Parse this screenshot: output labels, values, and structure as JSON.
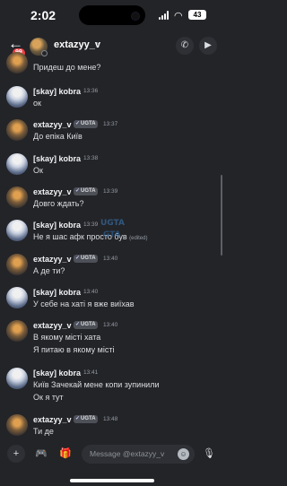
{
  "status_bar": {
    "time": "2:02",
    "battery": "43"
  },
  "header": {
    "back_icon": "arrow-left-icon",
    "unread_badge": "99",
    "username": "extazyy_v",
    "chevron": "›"
  },
  "messages": [
    {
      "text": "Придеш до мене?"
    },
    {
      "author": "[skay] kobra",
      "time": "13:36",
      "text": "ок"
    },
    {
      "author": "extazyy_v",
      "tag": "UGTA",
      "time": "13:37",
      "text": "До епіка Київ"
    },
    {
      "author": "[skay] kobra",
      "time": "13:38",
      "text": "Ок"
    },
    {
      "author": "extazyy_v",
      "tag": "UGTA",
      "time": "13:39",
      "text": "Довго ждать?"
    },
    {
      "author": "[skay] kobra",
      "time": "13:39",
      "text": "Не я шас афк просто був",
      "edited": "(edited)"
    },
    {
      "author": "extazyy_v",
      "tag": "UGTA",
      "time": "13:40",
      "text": "А де ти?"
    },
    {
      "author": "[skay] kobra",
      "time": "13:40",
      "text": "У себе на хаті я вже виїхав"
    },
    {
      "author": "extazyy_v",
      "tag": "UGTA",
      "time": "13:40",
      "text": "В якому місті хата",
      "text2": "Я питаю в якому місті"
    },
    {
      "author": "[skay] kobra",
      "time": "13:41",
      "text": "Київ Зачекай мене копи зупинили",
      "text2": "Ок я тут"
    },
    {
      "author": "extazyy_v",
      "tag": "UGTA",
      "time": "13:48",
      "text": "Ти де"
    }
  ],
  "composer": {
    "placeholder": "Message @extazyy_v"
  },
  "watermark": {
    "line1": "UGTA",
    "line2": "GTA"
  }
}
